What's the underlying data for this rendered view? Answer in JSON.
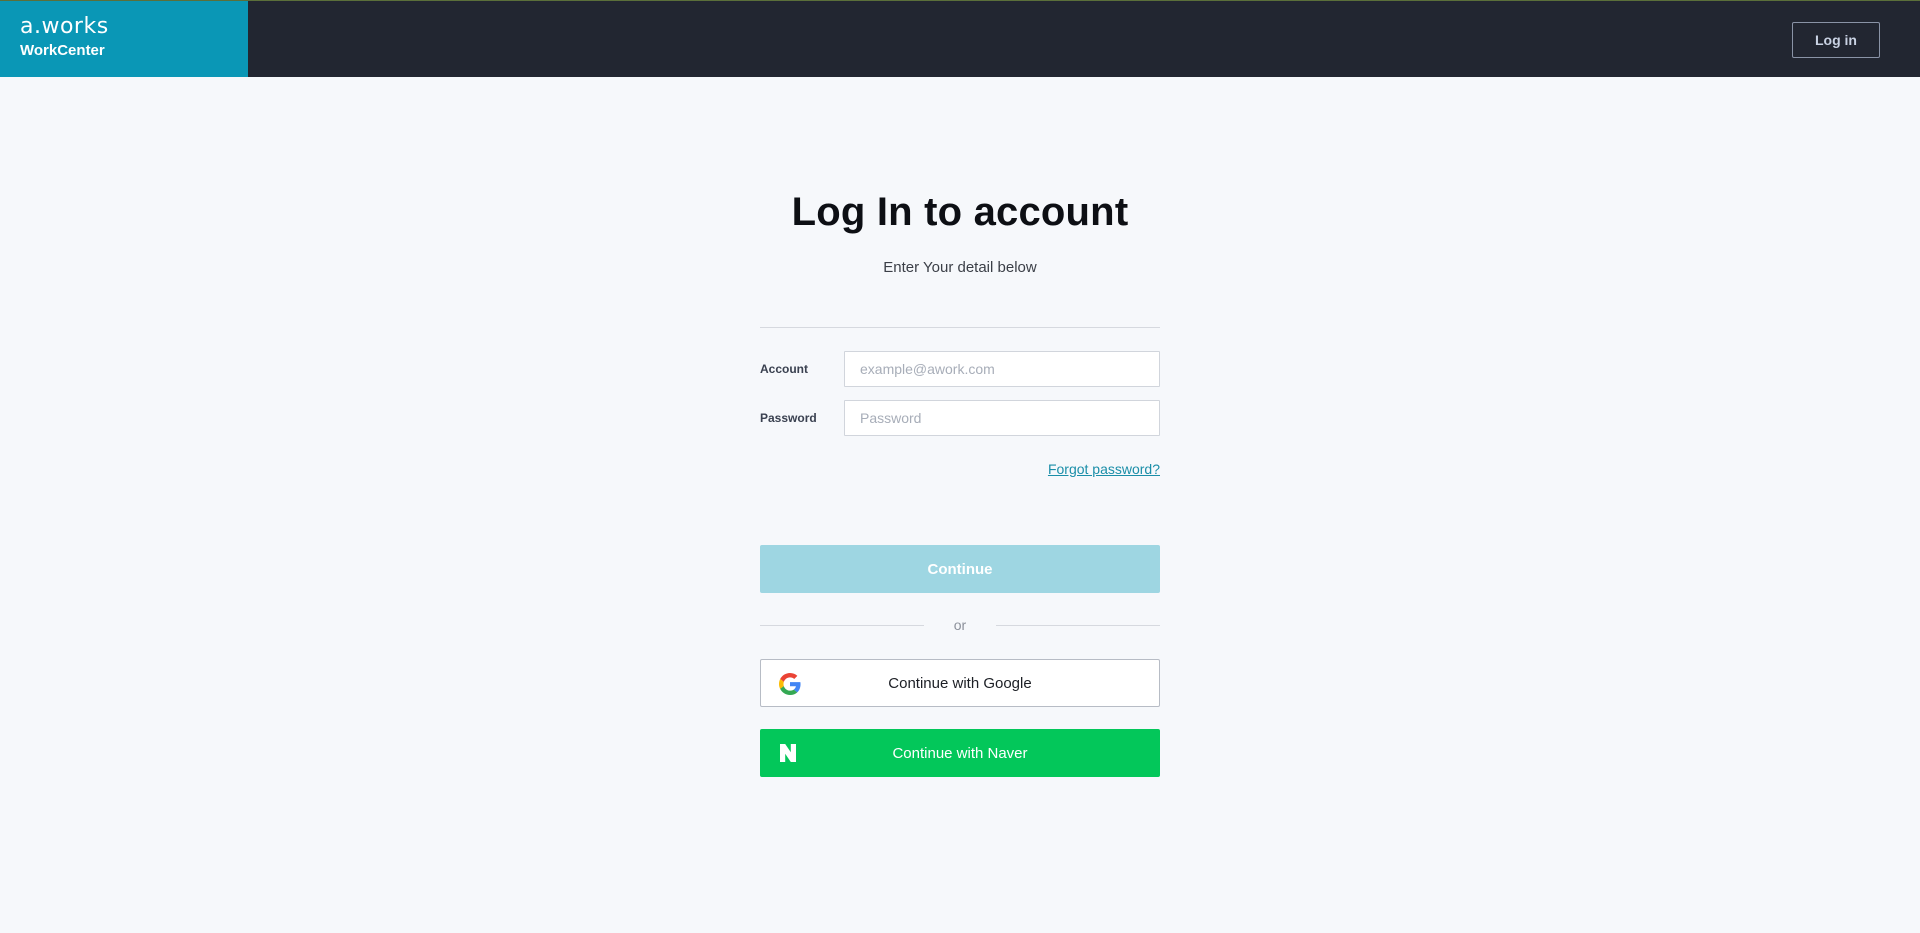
{
  "header": {
    "brand_logo": "a.works",
    "brand_name": "WorkCenter",
    "login_label": "Log in"
  },
  "form": {
    "title": "Log In to account",
    "subtitle": "Enter Your detail below",
    "account_label": "Account",
    "account_placeholder": "example@awork.com",
    "account_value": "",
    "password_label": "Password",
    "password_placeholder": "Password",
    "password_value": "",
    "forgot_label": "Forgot password?",
    "continue_label": "Continue",
    "or_label": "or",
    "google_label": "Continue with Google",
    "naver_label": "Continue with Naver"
  },
  "icons": {
    "google": "google-icon",
    "naver": "naver-icon"
  },
  "colors": {
    "brand": "#0a97b6",
    "header_bg": "#222631",
    "page_bg": "#f6f8fb",
    "continue_disabled": "#9ed6e2",
    "naver_green": "#03c75a",
    "link": "#1a8ea8"
  }
}
